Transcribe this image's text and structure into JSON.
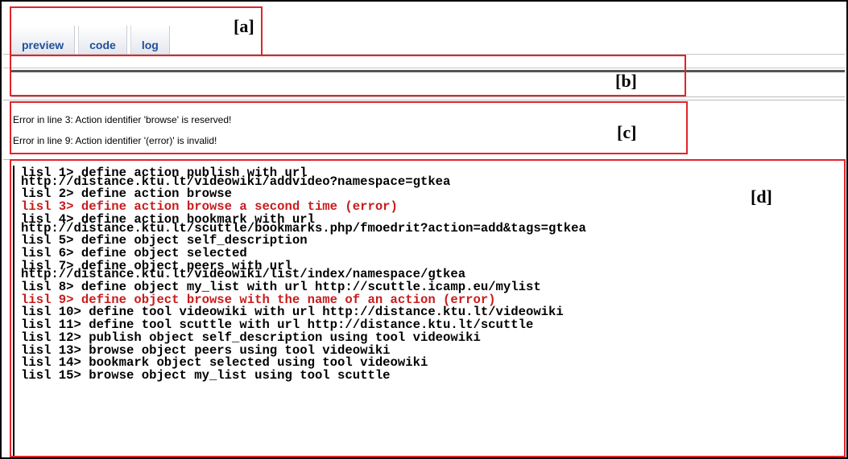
{
  "tabs": [
    "preview",
    "code",
    "log"
  ],
  "annotations": {
    "a": "[a]",
    "b": "[b]",
    "c": "[c]",
    "d": "[d]"
  },
  "errors": [
    "Error in line 3: Action identifier 'browse' is reserved!",
    "Error in line 9: Action identifier '(error)' is invalid!"
  ],
  "console": [
    {
      "text": "lisl 1> define action publish with url",
      "error": false
    },
    {
      "text": "http://distance.ktu.lt/videowiki/addvideo?namespace=gtkea",
      "error": false,
      "cont": true
    },
    {
      "text": "lisl 2> define action browse",
      "error": false
    },
    {
      "text": "lisl 3> define action browse a second time (error)",
      "error": true
    },
    {
      "text": "lisl 4> define action bookmark with url",
      "error": false
    },
    {
      "text": "http://distance.ktu.lt/scuttle/bookmarks.php/fmoedrit?action=add&tags=gtkea",
      "error": false,
      "cont": true
    },
    {
      "text": "lisl 5> define object self_description",
      "error": false
    },
    {
      "text": "lisl 6> define object selected",
      "error": false
    },
    {
      "text": "lisl 7> define object peers with url",
      "error": false
    },
    {
      "text": "http://distance.ktu.lt/videowiki/list/index/namespace/gtkea",
      "error": false,
      "cont": true
    },
    {
      "text": "lisl 8> define object my_list with url http://scuttle.icamp.eu/mylist",
      "error": false
    },
    {
      "text": "lisl 9> define object browse with the name of an action (error)",
      "error": true
    },
    {
      "text": "lisl 10> define tool videowiki with url http://distance.ktu.lt/videowiki",
      "error": false
    },
    {
      "text": "lisl 11> define tool scuttle with url http://distance.ktu.lt/scuttle",
      "error": false
    },
    {
      "text": "lisl 12> publish object self_description using tool videowiki",
      "error": false
    },
    {
      "text": "lisl 13> browse object peers using tool videowiki",
      "error": false
    },
    {
      "text": "lisl 14> bookmark object selected using tool videowiki",
      "error": false
    },
    {
      "text": "lisl 15> browse object my_list using tool scuttle",
      "error": false
    }
  ],
  "colors": {
    "tab_text": "#1f4f9a",
    "error_text": "#c81c1c",
    "annotation_box": "#e3232a"
  }
}
